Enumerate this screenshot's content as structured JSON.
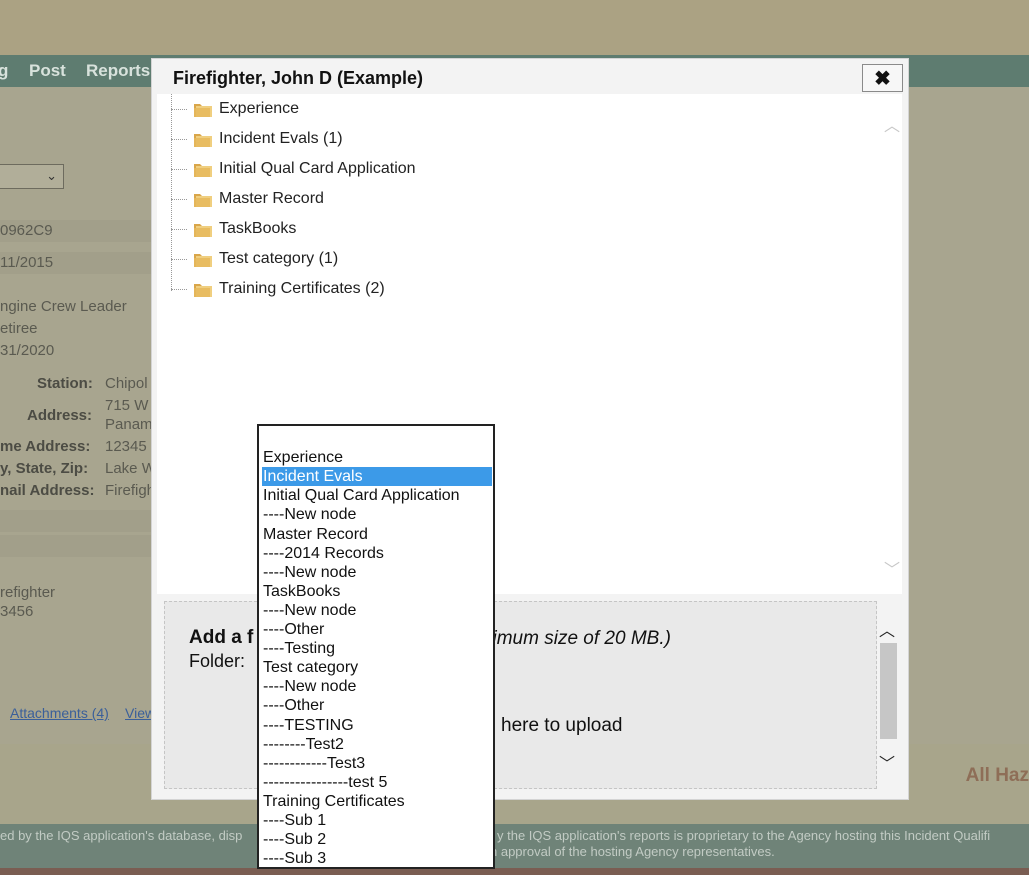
{
  "background": {
    "nav_items": [
      "g",
      "Post",
      "Reports"
    ],
    "fields": {
      "id_value": "0962C9",
      "date_value": "11/2015",
      "position_value": "ngine Crew Leader",
      "status_value": "etiree",
      "date2_value": "31/2020",
      "station_label": "Station:",
      "station_value": "Chipol",
      "address_label": "Address:",
      "address_value_1": "715 W",
      "address_value_2": "Panam",
      "home_address_label": "me Address:",
      "home_address_value": "12345",
      "city_label": "y, State, Zip:",
      "city_value": "Lake W",
      "email_label": "nail Address:",
      "email_value": "Firefigh",
      "title_value": "refighter",
      "number_value": "3456"
    },
    "links": {
      "attachments": "Attachments (4)",
      "view": "View"
    },
    "footer_right": "All Haz",
    "footer_line_1": "ed by the IQS application's database, disp",
    "footer_line_1b": "y the IQS application's reports is proprietary to the Agency hosting this Incident Qualifi",
    "footer_line_2b": "n approval of the hosting Agency representatives."
  },
  "modal": {
    "title": "Firefighter, John D (Example)",
    "close_glyph": "✖",
    "tree": [
      {
        "label": "Experience"
      },
      {
        "label": "Incident Evals (1)"
      },
      {
        "label": "Initial Qual Card Application"
      },
      {
        "label": "Master Record"
      },
      {
        "label": "TaskBooks"
      },
      {
        "label": "Test category (1)"
      },
      {
        "label": "Training Certificates (2)"
      }
    ],
    "upload": {
      "title_prefix": "Add a f",
      "hint_suffix": "ximum size of 20 MB.)",
      "folder_label": "Folder:",
      "drop_suffix": "here to upload"
    }
  },
  "dropdown": {
    "selected_index": 2,
    "options": [
      "",
      "Experience",
      "Incident Evals",
      "Initial Qual Card Application",
      "----New node",
      "Master Record",
      "----2014 Records",
      "----New node",
      "TaskBooks",
      "----New node",
      "----Other",
      "----Testing",
      "Test category",
      "----New node",
      "----Other",
      "----TESTING",
      "--------Test2",
      "------------Test3",
      "----------------test 5",
      "Training Certificates",
      "----Sub 1",
      "----Sub 2",
      "----Sub 3"
    ]
  },
  "colors": {
    "selected_option": "#3c9ae8",
    "folder_icon": "#e8b95a"
  }
}
